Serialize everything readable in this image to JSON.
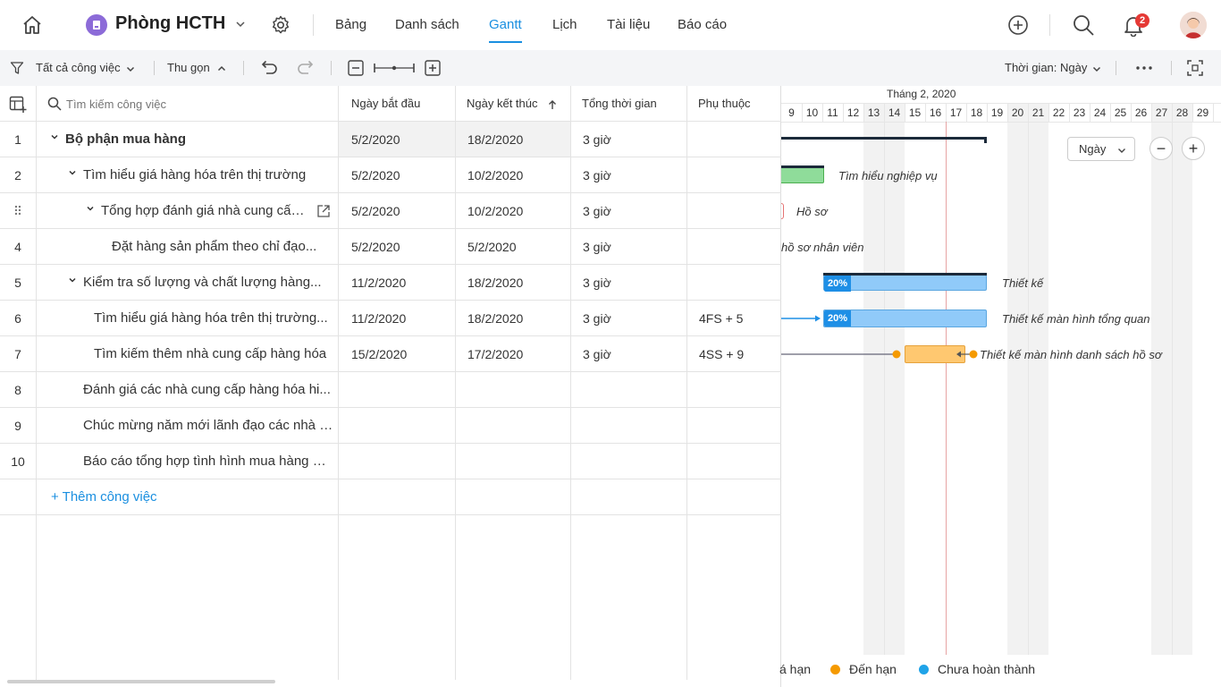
{
  "header": {
    "workspace_name": "Phòng HCTH",
    "tabs": [
      {
        "label": "Bảng"
      },
      {
        "label": "Danh sách"
      },
      {
        "label": "Gantt"
      },
      {
        "label": "Lịch"
      },
      {
        "label": "Tài liệu"
      },
      {
        "label": "Báo cáo"
      }
    ],
    "active_tab": "Gantt",
    "notification_count": "2"
  },
  "toolbar": {
    "filter_label": "Tất cả công việc",
    "collapse_label": "Thu gọn",
    "time_scale_label": "Thời gian: Ngày"
  },
  "grid": {
    "search_placeholder": "Tìm kiếm công việc",
    "columns": {
      "start": "Ngày bắt đầu",
      "end": "Ngày kết thúc",
      "duration": "Tổng thời gian",
      "dependency": "Phụ thuộc"
    },
    "rows": [
      {
        "num": "1",
        "name": "Bộ phận mua hàng",
        "start": "5/2/2020",
        "end": "18/2/2020",
        "duration": "3 giờ",
        "dep": ""
      },
      {
        "num": "2",
        "name": "Tìm hiểu giá hàng hóa trên thị trường",
        "start": "5/2/2020",
        "end": "10/2/2020",
        "duration": "3 giờ",
        "dep": ""
      },
      {
        "num": "⠿",
        "name": "Tổng hợp đánh giá nhà cung cấp...",
        "start": "5/2/2020",
        "end": "10/2/2020",
        "duration": "3 giờ",
        "dep": ""
      },
      {
        "num": "4",
        "name": "Đặt hàng sản phẩm theo chỉ đạo...",
        "start": "5/2/2020",
        "end": "5/2/2020",
        "duration": "3 giờ",
        "dep": ""
      },
      {
        "num": "5",
        "name": "Kiểm tra số lượng và chất lượng hàng...",
        "start": "11/2/2020",
        "end": "18/2/2020",
        "duration": "3 giờ",
        "dep": ""
      },
      {
        "num": "6",
        "name": "Tìm hiểu giá hàng hóa trên thị trường...",
        "start": "11/2/2020",
        "end": "18/2/2020",
        "duration": "3 giờ",
        "dep": "4FS + 5"
      },
      {
        "num": "7",
        "name": "Tìm kiếm thêm nhà cung cấp hàng hóa",
        "start": "15/2/2020",
        "end": "17/2/2020",
        "duration": "3 giờ",
        "dep": "4SS + 9"
      },
      {
        "num": "8",
        "name": "Đánh giá các nhà cung cấp hàng hóa hi...",
        "start": "",
        "end": "",
        "duration": "",
        "dep": ""
      },
      {
        "num": "9",
        "name": "Chúc mừng năm mới lãnh đạo các nhà c...",
        "start": "",
        "end": "",
        "duration": "",
        "dep": ""
      },
      {
        "num": "10",
        "name": "Báo cáo tổng hợp tình hình mua hàng 6 ...",
        "start": "",
        "end": "",
        "duration": "",
        "dep": ""
      }
    ],
    "add_task_label": "+ Thêm công việc"
  },
  "gantt": {
    "month_label": "Tháng 2, 2020",
    "days": [
      "9",
      "10",
      "11",
      "12",
      "13",
      "14",
      "15",
      "16",
      "17",
      "18",
      "19",
      "20",
      "21",
      "22",
      "23",
      "24",
      "25",
      "26",
      "27",
      "28",
      "29"
    ],
    "zoom_select_label": "Ngày",
    "bar_labels": {
      "r2": "Tìm hiểu nghiệp vụ",
      "r3": "Hồ sơ",
      "r4": "hồ sơ nhân viên",
      "r5": "Thiết kế",
      "r6": "Thiết kế màn hình tổng quan",
      "r7": "Thiết kế màn hình danh sách hồ sơ"
    },
    "progress": {
      "r5": "20%",
      "r6": "20%"
    },
    "legend": [
      {
        "label": "á hạn",
        "color": "#e53935"
      },
      {
        "label": "Đến hạn",
        "color": "#f59a00"
      },
      {
        "label": "Chưa hoàn thành",
        "color": "#1fa3e8"
      }
    ],
    "colors": {
      "accent": "#1a8fe0",
      "green_bar": "#8fdc9a",
      "blue_bar": "#90caf9",
      "orange_bar": "#ffc870"
    }
  }
}
